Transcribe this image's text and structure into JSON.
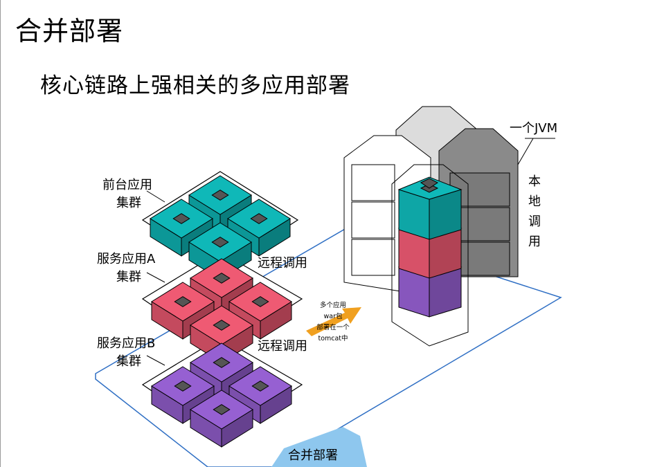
{
  "slide": {
    "title": "合并部署",
    "subtitle": "核心链路上强相关的多应用部署"
  },
  "clusters": {
    "frontend": {
      "line1": "前台应用",
      "line2": "集群"
    },
    "service_a": {
      "line1": "服务应用A",
      "line2": "集群"
    },
    "service_b": {
      "line1": "服务应用B",
      "line2": "集群"
    }
  },
  "remote_call_label": "远程调用",
  "arrow_note": [
    "多个应用",
    "war包",
    "部署在一个",
    "tomcat中"
  ],
  "jvm_label": "一个JVM",
  "local_call_chars": [
    "本",
    "地",
    "调",
    "用"
  ],
  "bottom_label": "合并部署",
  "colors": {
    "teal": "#0fb8b8",
    "pink": "#ef5a73",
    "purple": "#9660d2",
    "arrow": "#f0a020",
    "platform_edge": "#2f6fc4",
    "label_tab": "#8ec7ee",
    "jvm_gray": "#8a8a8a"
  }
}
